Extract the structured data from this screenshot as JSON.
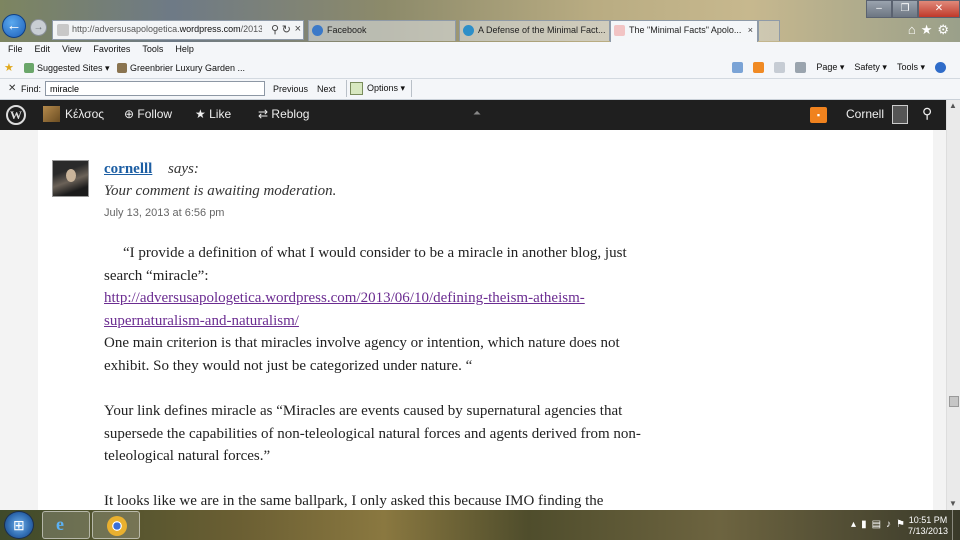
{
  "browser": {
    "address": {
      "prefix": "http://adversusapologetica.",
      "host": "wordpress.com",
      "rest": "/2013"
    },
    "tabs": [
      {
        "label": "Facebook"
      },
      {
        "label": "A Defense of the Minimal Fact..."
      },
      {
        "label": "The \"Minimal Facts\" Apolo...",
        "active": true
      }
    ],
    "menu": [
      "File",
      "Edit",
      "View",
      "Favorites",
      "Tools",
      "Help"
    ],
    "favorites": [
      "Suggested Sites ▾",
      "Greenbrier Luxury Garden ..."
    ],
    "command_bar": [
      "Page ▾",
      "Safety ▾",
      "Tools ▾"
    ],
    "find": {
      "label": "Find:",
      "value": "miracle",
      "previous": "Previous",
      "next": "Next",
      "options": "Options"
    }
  },
  "wpbar": {
    "site": "Κέλσος",
    "follow": "Follow",
    "like": "Like",
    "reblog": "Reblog",
    "user": "Cornell"
  },
  "comment": {
    "author": "cornelll",
    "says": "says:",
    "moderation": "Your comment is awaiting moderation.",
    "date": "July 13, 2013 at 6:56 pm",
    "para1_a": "“I provide a definition of what I would consider to be a miracle in another blog, just search “miracle”:",
    "link": "http://adversusapologetica.wordpress.com/2013/06/10/defining-theism-atheism-supernaturalism-and-naturalism/",
    "para1_b": "One main criterion is that miracles involve agency or intention, which nature does not exhibit. So they would not just be categorized under nature. “",
    "para2": "Your link defines miracle as “Miracles are events caused by supernatural agencies that supersede the capabilities of non-teleological natural forces and agents derived from non-teleological natural forces.”",
    "para3": "It looks like we are in the same ballpark, I only asked this because IMO finding the"
  },
  "taskbar": {
    "time": "10:51 PM",
    "date": "7/13/2013"
  }
}
